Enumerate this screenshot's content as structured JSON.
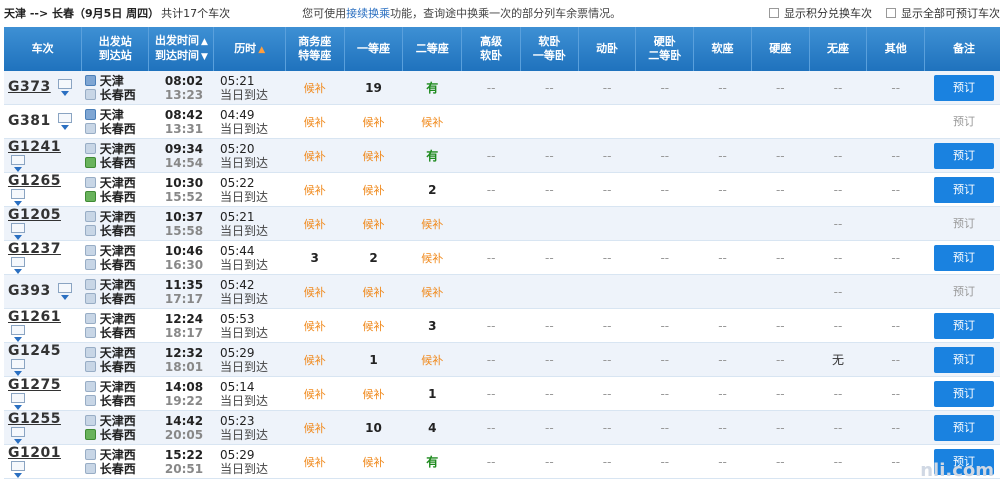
{
  "header": {
    "route": "天津 --> 长春（9月5日 周四）",
    "count": "共计17个车次",
    "tip_prefix": "您可使用",
    "tip_link": "接续换乘",
    "tip_suffix": "功能，查询途中换乘一次的部分列车余票情况。",
    "opt1": "显示积分兑换车次",
    "opt2": "显示全部可预订车次"
  },
  "columns": {
    "train": "车次",
    "station1": "出发站",
    "station2": "到达站",
    "time1": "出发时间",
    "time2": "到达时间",
    "dur": "历时",
    "swz1": "商务座",
    "swz2": "特等座",
    "ydz": "一等座",
    "edz": "二等座",
    "gjrw1": "高级",
    "gjrw2": "软卧",
    "rw1": "软卧",
    "rw2": "一等卧",
    "dw": "动卧",
    "yw1": "硬卧",
    "yw2": "二等卧",
    "rz": "软座",
    "yz": "硬座",
    "wz": "无座",
    "qt": "其他",
    "note": "备注"
  },
  "sort_arrow": "▲",
  "icons": {
    "ticket_card": "ticket-card-icon",
    "expand": "chevron-down-icon",
    "start": "start-station-icon",
    "end": "end-station-icon"
  },
  "colors": {
    "header": "#1f72bd",
    "book": "#1a82e0",
    "candidate": "#f08a1d",
    "available": "#1e8a1e"
  },
  "trains": [
    {
      "no": "G373",
      "u": true,
      "from": "天津",
      "to": "长春西",
      "fi": "start",
      "ti": "pass",
      "dep": "08:02",
      "arr": "13:23",
      "dur": "05:21",
      "day": "当日到达",
      "swz": "候补",
      "ydz": "19",
      "edz": "有",
      "wz": "--",
      "book": "预订",
      "bk": true
    },
    {
      "no": "G381",
      "u": false,
      "from": "天津",
      "to": "长春西",
      "fi": "start",
      "ti": "pass",
      "dep": "08:42",
      "arr": "13:31",
      "dur": "04:49",
      "day": "当日到达",
      "swz": "候补",
      "ydz": "候补",
      "edz": "候补",
      "wz": "",
      "book": "预订",
      "bk": false
    },
    {
      "no": "G1241",
      "u": true,
      "from": "天津西",
      "to": "长春西",
      "fi": "pass",
      "ti": "end",
      "dep": "09:34",
      "arr": "14:54",
      "dur": "05:20",
      "day": "当日到达",
      "swz": "候补",
      "ydz": "候补",
      "edz": "有",
      "wz": "--",
      "book": "预订",
      "bk": true
    },
    {
      "no": "G1265",
      "u": true,
      "from": "天津西",
      "to": "长春西",
      "fi": "pass",
      "ti": "end",
      "dep": "10:30",
      "arr": "15:52",
      "dur": "05:22",
      "day": "当日到达",
      "swz": "候补",
      "ydz": "候补",
      "edz": "2",
      "wz": "--",
      "book": "预订",
      "bk": true
    },
    {
      "no": "G1205",
      "u": true,
      "from": "天津西",
      "to": "长春西",
      "fi": "pass",
      "ti": "pass",
      "dep": "10:37",
      "arr": "15:58",
      "dur": "05:21",
      "day": "当日到达",
      "swz": "候补",
      "ydz": "候补",
      "edz": "候补",
      "wz": "--",
      "book": "预订",
      "bk": false
    },
    {
      "no": "G1237",
      "u": true,
      "from": "天津西",
      "to": "长春西",
      "fi": "pass",
      "ti": "pass",
      "dep": "10:46",
      "arr": "16:30",
      "dur": "05:44",
      "day": "当日到达",
      "swz": "3",
      "ydz": "2",
      "edz": "候补",
      "wz": "--",
      "book": "预订",
      "bk": true
    },
    {
      "no": "G393",
      "u": false,
      "from": "天津西",
      "to": "长春西",
      "fi": "pass",
      "ti": "pass",
      "dep": "11:35",
      "arr": "17:17",
      "dur": "05:42",
      "day": "当日到达",
      "swz": "候补",
      "ydz": "候补",
      "edz": "候补",
      "wz": "--",
      "book": "预订",
      "bk": false
    },
    {
      "no": "G1261",
      "u": true,
      "from": "天津西",
      "to": "长春西",
      "fi": "pass",
      "ti": "pass",
      "dep": "12:24",
      "arr": "18:17",
      "dur": "05:53",
      "day": "当日到达",
      "swz": "候补",
      "ydz": "候补",
      "edz": "3",
      "wz": "--",
      "book": "预订",
      "bk": true
    },
    {
      "no": "G1245",
      "u": false,
      "from": "天津西",
      "to": "长春西",
      "fi": "pass",
      "ti": "pass",
      "dep": "12:32",
      "arr": "18:01",
      "dur": "05:29",
      "day": "当日到达",
      "swz": "候补",
      "ydz": "1",
      "edz": "候补",
      "wz": "无",
      "book": "预订",
      "bk": true
    },
    {
      "no": "G1275",
      "u": true,
      "from": "天津西",
      "to": "长春西",
      "fi": "pass",
      "ti": "pass",
      "dep": "14:08",
      "arr": "19:22",
      "dur": "05:14",
      "day": "当日到达",
      "swz": "候补",
      "ydz": "候补",
      "edz": "1",
      "wz": "--",
      "book": "预订",
      "bk": true
    },
    {
      "no": "G1255",
      "u": true,
      "from": "天津西",
      "to": "长春西",
      "fi": "pass",
      "ti": "end",
      "dep": "14:42",
      "arr": "20:05",
      "dur": "05:23",
      "day": "当日到达",
      "swz": "候补",
      "ydz": "10",
      "edz": "4",
      "wz": "--",
      "book": "预订",
      "bk": true
    },
    {
      "no": "G1201",
      "u": true,
      "from": "天津西",
      "to": "长春西",
      "fi": "pass",
      "ti": "pass",
      "dep": "15:22",
      "arr": "20:51",
      "dur": "05:29",
      "day": "当日到达",
      "swz": "候补",
      "ydz": "候补",
      "edz": "有",
      "wz": "--",
      "book": "预订",
      "bk": true
    }
  ],
  "watermark": "nli.com"
}
